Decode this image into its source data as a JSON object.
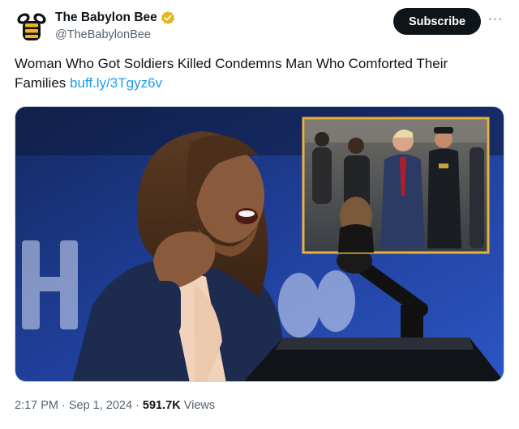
{
  "author": {
    "display_name": "The Babylon Bee",
    "handle": "@TheBabylonBee",
    "avatar_icon": "bee-logo-icon",
    "verified_icon": "gold-verified-badge-icon"
  },
  "actions": {
    "subscribe_label": "Subscribe",
    "more_label": "···"
  },
  "tweet": {
    "text": "Woman Who Got Soldiers Killed Condemns Man Who Comforted Their Families",
    "link_text": "buff.ly/3Tgyz6v"
  },
  "media": {
    "inset_border_color": "#e8b23c",
    "backdrop_color": "#1f3f9a"
  },
  "meta": {
    "time": "2:17 PM",
    "date": "Sep 1, 2024",
    "views_count": "591.7K",
    "views_label": "Views"
  },
  "colors": {
    "link": "#1d9bf0",
    "button_bg": "#0f1419",
    "secondary_text": "#536471"
  }
}
